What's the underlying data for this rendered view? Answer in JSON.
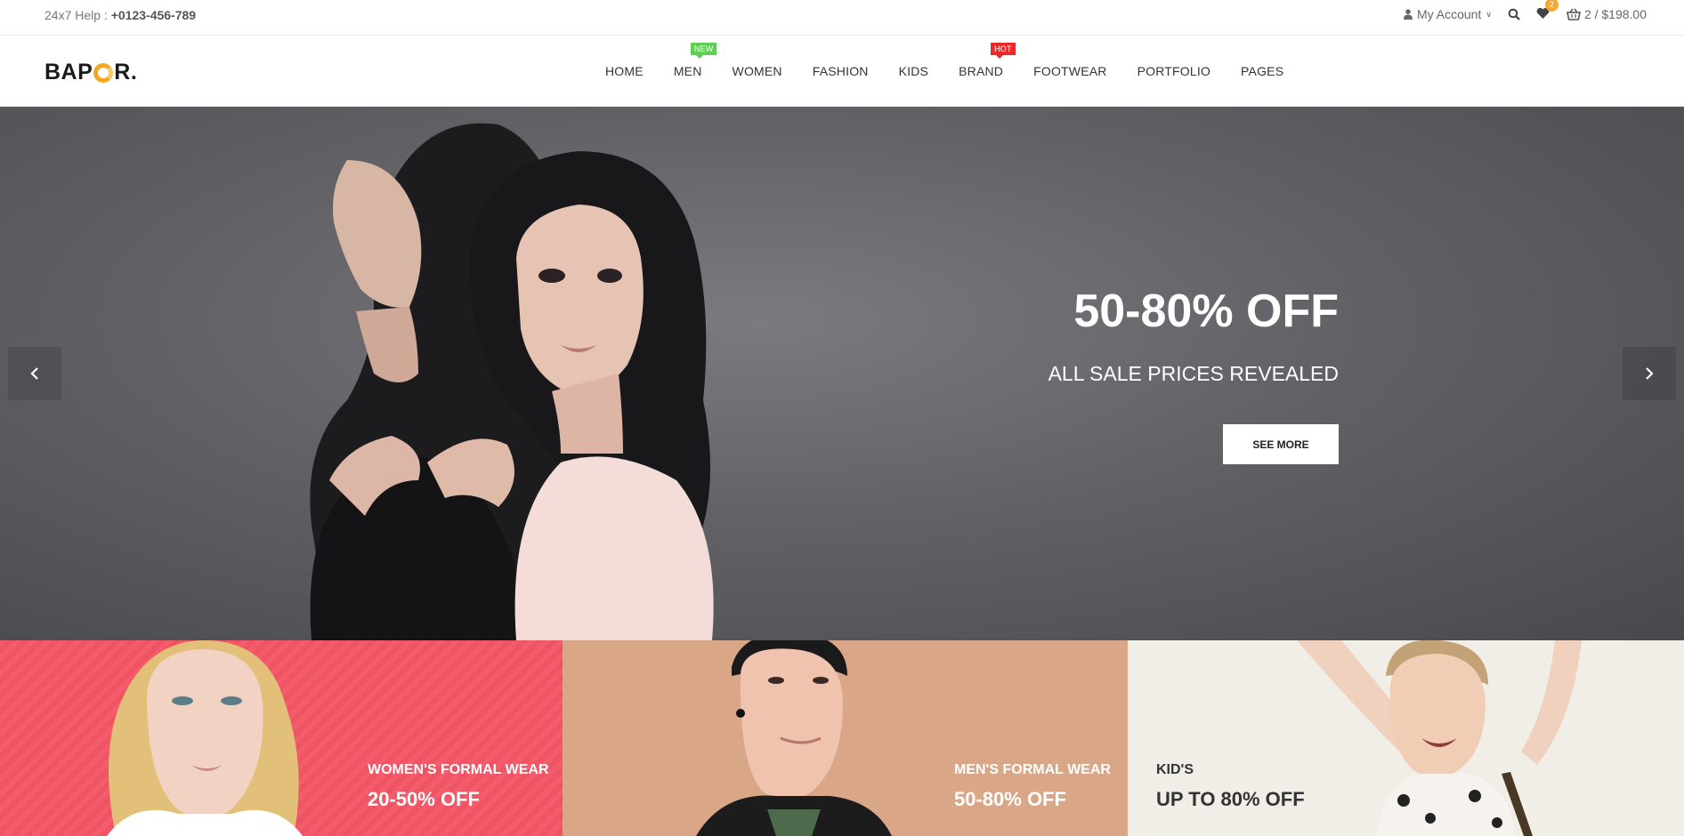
{
  "topbar": {
    "help_label": "24x7 Help :",
    "help_phone": "+0123-456-789",
    "account_label": "My Account",
    "wishlist_count": "2",
    "cart_summary": "2 / $198.00"
  },
  "header": {
    "logo_text_left": "BAP",
    "logo_text_right": "R.",
    "nav": [
      {
        "label": "HOME"
      },
      {
        "label": "MEN",
        "tag": "NEW"
      },
      {
        "label": "WOMEN"
      },
      {
        "label": "FASHION"
      },
      {
        "label": "KIDS"
      },
      {
        "label": "BRAND",
        "tag": "HOT"
      },
      {
        "label": "FOOTWEAR"
      },
      {
        "label": "PORTFOLIO"
      },
      {
        "label": "PAGES"
      }
    ]
  },
  "hero": {
    "title": "50-80% OFF",
    "subtitle": "ALL SALE PRICES REVEALED",
    "button_label": "SEE MORE"
  },
  "banners": [
    {
      "title": "WOMEN'S FORMAL WEAR",
      "offer": "20-50% OFF"
    },
    {
      "title": "MEN'S FORMAL WEAR",
      "offer": "50-80% OFF"
    },
    {
      "title": "KID'S",
      "offer": "UP TO 80% OFF"
    }
  ],
  "colors": {
    "accent": "#f5a623",
    "new_tag": "#5fcf54",
    "hot_tag": "#ea2a2a",
    "women_banner": "#f35c6b",
    "men_banner": "#d9a788",
    "kids_banner": "#f1eee8"
  },
  "icons": [
    "user-icon",
    "chevron-down-icon",
    "search-icon",
    "heart-icon",
    "basket-icon",
    "chevron-left-icon",
    "chevron-right-icon"
  ]
}
